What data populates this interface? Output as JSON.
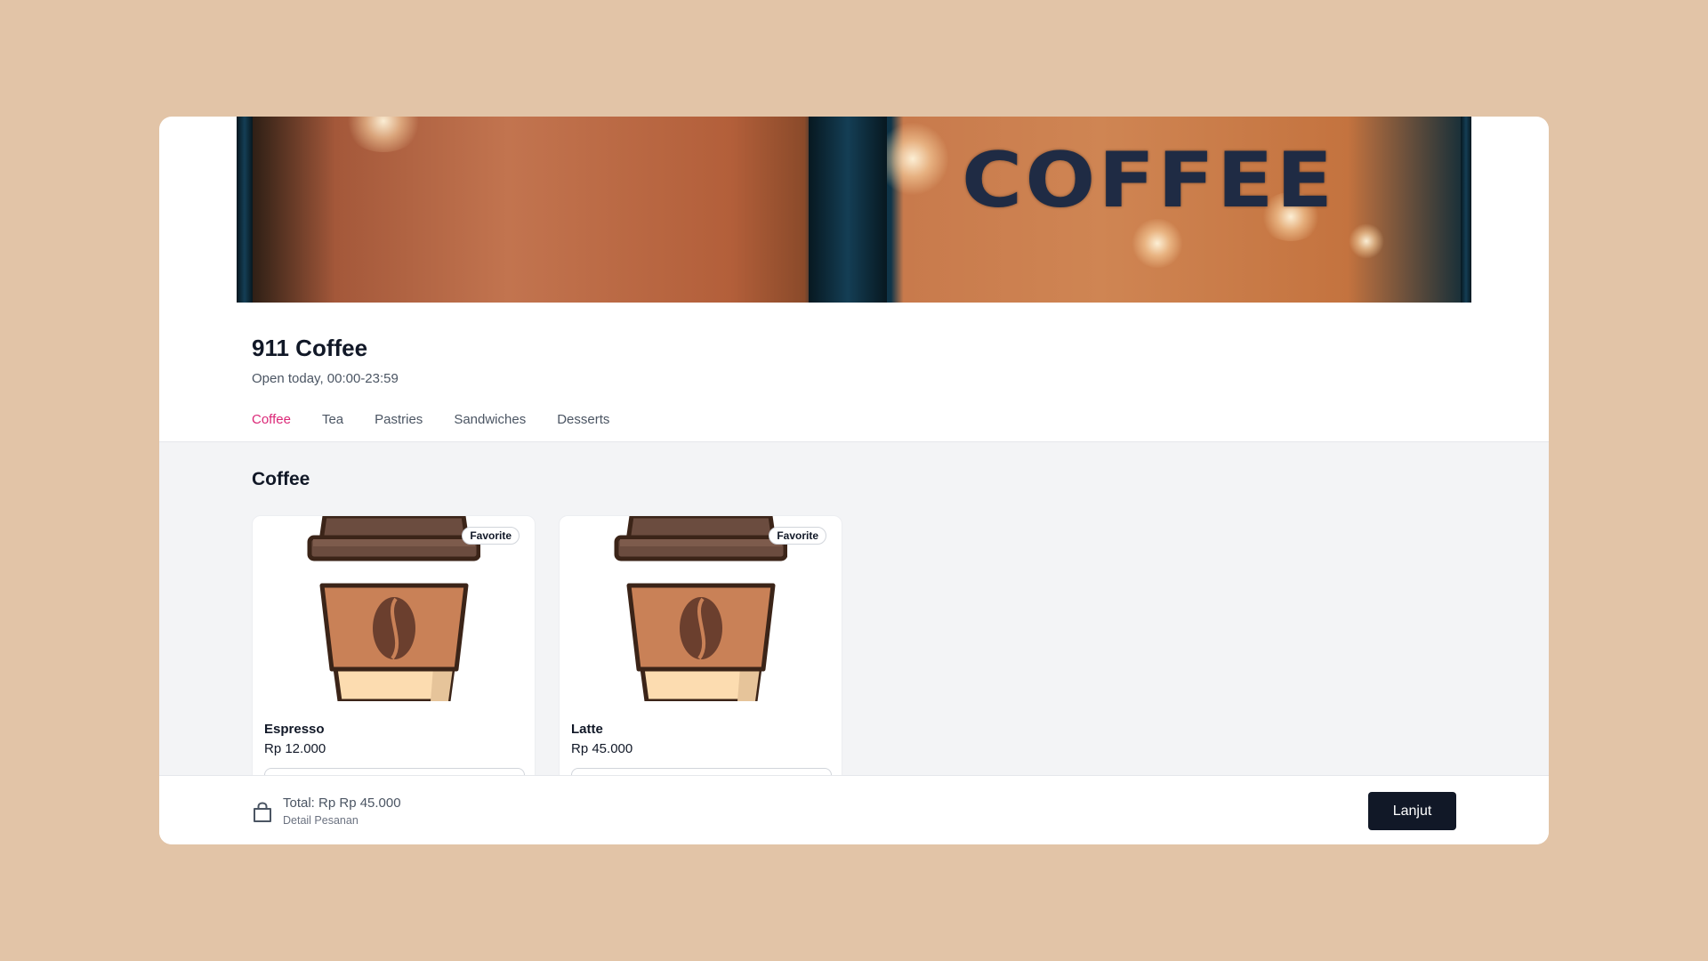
{
  "hero": {
    "sign_text": "COFFEE"
  },
  "shop": {
    "name": "911 Coffee",
    "hours": "Open today, 00:00-23:59"
  },
  "tabs": [
    {
      "label": "Coffee",
      "active": true
    },
    {
      "label": "Tea",
      "active": false
    },
    {
      "label": "Pastries",
      "active": false
    },
    {
      "label": "Sandwiches",
      "active": false
    },
    {
      "label": "Desserts",
      "active": false
    }
  ],
  "section": {
    "title": "Coffee"
  },
  "products": [
    {
      "name": "Espresso",
      "price": "Rp 12.000",
      "badge": "Favorite",
      "image_icon": "coffee-cup-icon"
    },
    {
      "name": "Latte",
      "price": "Rp 45.000",
      "badge": "Favorite",
      "image_icon": "coffee-cup-icon"
    }
  ],
  "footer": {
    "total": "Total: Rp Rp 45.000",
    "detail": "Detail Pesanan",
    "button_label": "Lanjut",
    "bag_icon": "shopping-bag-icon"
  },
  "colors": {
    "page_background": "#e2c4a7",
    "active_tab": "#db2777",
    "primary_button": "#111827",
    "content_background": "#f3f4f6"
  }
}
